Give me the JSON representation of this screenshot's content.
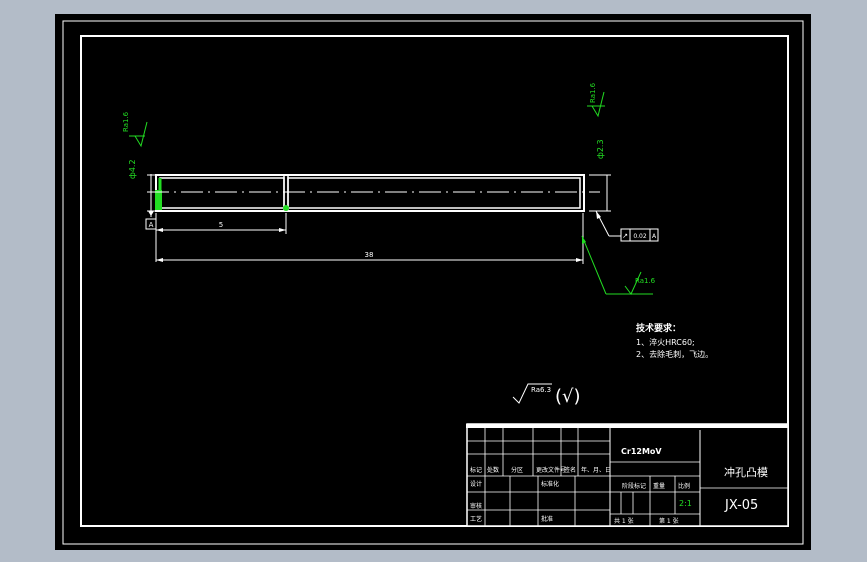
{
  "drawing": {
    "dim_length_total": "38",
    "dim_length_step": "5",
    "diameter_left": "ф4.2",
    "diameter_right": "ф2.3",
    "roughness_left": "Ra1.6",
    "roughness_right": "Ra1.6",
    "roughness_bottom": "Ra1.6",
    "datum_label": "A",
    "tolerance_symbol": "↗",
    "tolerance_value": "0.02",
    "tolerance_datum": "A"
  },
  "notes": {
    "heading": "技术要求：",
    "items": [
      "1、淬火HRC60;",
      "2、去除毛刺，飞边。"
    ]
  },
  "general_roughness": {
    "value": "Ra6.3",
    "paren_symbol": "(√)"
  },
  "title_block": {
    "material": "Cr12MoV",
    "part_name": "冲孔凸模",
    "drawing_number": "JX-05",
    "scale": "2:1",
    "header_row": [
      "标记",
      "处数",
      "分区",
      "更改文件号",
      "签名",
      "年、月、日"
    ],
    "design_label": "设计",
    "standard_label": "标准化",
    "review_label": "审核",
    "process_label": "工艺",
    "approve_label": "批准",
    "stage_label": "阶段标记",
    "weight_label": "重量",
    "scale_label": "比例",
    "sheet_total": "共 1 张",
    "sheet_num": "第 1 张"
  }
}
